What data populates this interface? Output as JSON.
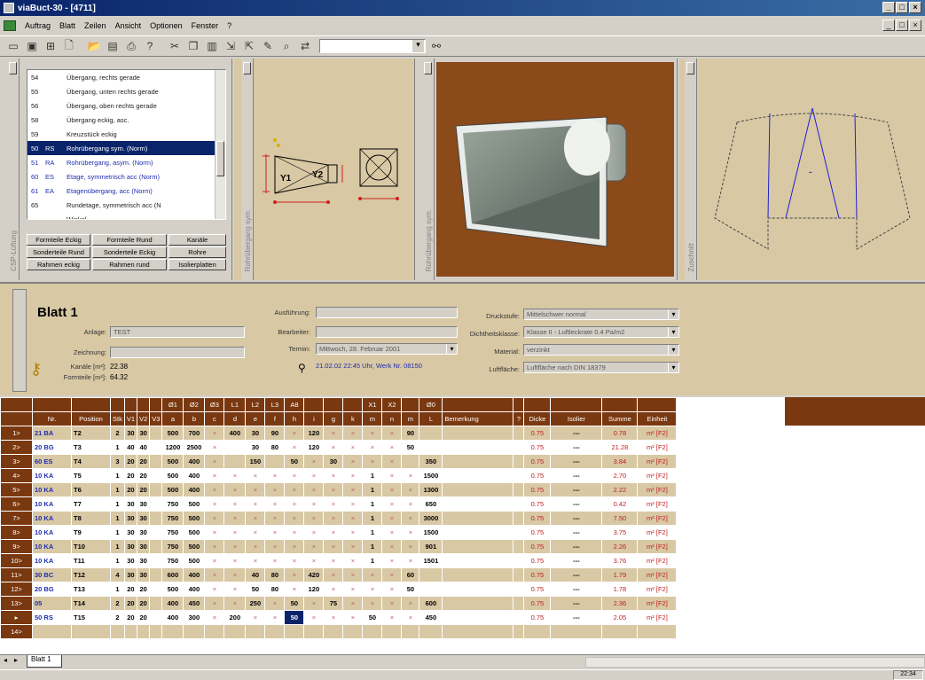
{
  "window": {
    "title": "viaBuct-30 - [4711]",
    "minimize": "_",
    "maximize": "□",
    "close": "×"
  },
  "menu": [
    "Auftrag",
    "Blatt",
    "Zeilen",
    "Ansicht",
    "Optionen",
    "Fenster",
    "?"
  ],
  "parts_list": {
    "rows": [
      {
        "n": "54",
        "code": "",
        "name": "Übergang, rechts gerade"
      },
      {
        "n": "55",
        "code": "",
        "name": "Übergang, unten rechts gerade"
      },
      {
        "n": "56",
        "code": "",
        "name": "Übergang, oben rechts gerade"
      },
      {
        "n": "58",
        "code": "",
        "name": "Übergang eckig, asc."
      },
      {
        "n": "59",
        "code": "",
        "name": "Kreuzstück eckig"
      },
      {
        "n": "50",
        "code": "RS",
        "name": "Rohrübergang sym. (Norm)",
        "selected": true
      },
      {
        "n": "51",
        "code": "RA",
        "name": "Rohrübergang, asym. (Norm)"
      },
      {
        "n": "60",
        "code": "ES",
        "name": "Etage, symmetrisch acc (Norm)"
      },
      {
        "n": "61",
        "code": "EA",
        "name": "Etagenübergang, acc (Norm)"
      },
      {
        "n": "65",
        "code": "",
        "name": "Rundetage, symmetrisch acc (N"
      },
      {
        "n": "",
        "code": "",
        "name": "Winkel"
      }
    ],
    "buttons": [
      [
        "Formteile Eckig",
        "Formteile Rund",
        "Kanäle"
      ],
      [
        "Sonderteile Rund",
        "Sonderteile Eckig",
        "Rohre"
      ],
      [
        "Rahmen eckig",
        "Rahmen rund",
        "Isolierplatten"
      ]
    ],
    "strip_label": "CSP-Lüftung"
  },
  "drawing": {
    "labels": [
      "Y1",
      "Y2"
    ],
    "strip_label": "Rohrübergang sym."
  },
  "view3d": {
    "strip_label": "Rohrübergang sym."
  },
  "unfold": {
    "strip_label": "Zuschnitt"
  },
  "sheet": {
    "title": "Blatt 1",
    "anlage_label": "Anlage:",
    "anlage_value": "TEST",
    "zeichnung_label": "Zeichnung:",
    "zeichnung_value": "",
    "kanaele_label": "Kanäle [m²]:",
    "kanaele_value": "22.38",
    "formteile_label": "Formteile [m²]:",
    "formteile_value": "64.32",
    "ausfuehrung_label": "Ausführung:",
    "ausfuehrung_value": "",
    "bearbeiter_label": "Bearbeiter:",
    "bearbeiter_value": "",
    "termin_label": "Termin:",
    "termin_value": "Mittwoch, 28. Februar 2001",
    "info_text": "21.02.02 22:45 Uhr, Werk Nr. 08150",
    "drucksfufe_label": "Druckstufe:",
    "drucksfufe_value": "Mittelschwer normal",
    "dichtheit_label": "Dichtheitsklasse:",
    "dichtheit_value": "Klasse II - Luftleckrate 0.4 Pa/m2",
    "material_label": "Material:",
    "material_value": "verzinkt",
    "luftflaeche_label": "Luftfläche:",
    "luftflaeche_value": "Luftfläche nach DIN 18379"
  },
  "grid": {
    "header1": [
      "",
      "",
      "",
      "",
      "",
      "",
      "",
      "Ø1",
      "Ø2",
      "Ø3",
      "L1",
      "L2",
      "L3",
      "A8",
      "",
      "",
      "",
      "X1",
      "X2",
      "",
      "Ø0",
      "",
      "",
      "",
      "",
      "",
      ""
    ],
    "header2": [
      "",
      "Nr.",
      "Position",
      "Stk",
      "V1",
      "V2",
      "V3",
      "a",
      "b",
      "c",
      "d",
      "e",
      "f",
      "h",
      "i",
      "g",
      "k",
      "m",
      "n",
      "m",
      "L",
      "Bemerkung",
      "?",
      "Dicke",
      "Isolier",
      "Summe",
      "Einheit"
    ],
    "rows": [
      {
        "rh": "1>",
        "nr": "21 BA",
        "pos": "T2",
        "stk": "2",
        "v1": "30",
        "v2": "30",
        "a": "500",
        "b": "700",
        "d": "400",
        "e": "30",
        "f": "90",
        "i": "120",
        "m": "90",
        "L": "",
        "dicke": "0.75",
        "iso": "---",
        "summe": "0.78",
        "einheit": "m² [F2]"
      },
      {
        "rh": "2>",
        "nr": "20 BG",
        "pos": "T3",
        "stk": "1",
        "v1": "40",
        "v2": "40",
        "a": "1200",
        "b": "2500",
        "d": "",
        "e": "30",
        "f": "80",
        "i": "120",
        "m": "50",
        "L": "",
        "dicke": "0.75",
        "iso": "---",
        "summe": "21.28",
        "einheit": "m² [F2]"
      },
      {
        "rh": "3>",
        "nr": "60 ES",
        "pos": "T4",
        "stk": "3",
        "v1": "20",
        "v2": "20",
        "a": "500",
        "b": "400",
        "d": "",
        "e": "150",
        "f": "",
        "h": "50",
        "g": "30",
        "m": "",
        "L": "350",
        "dicke": "0.75",
        "iso": "---",
        "summe": "3.84",
        "einheit": "m² [F2]"
      },
      {
        "rh": "4>",
        "nr": "10 KA",
        "pos": "T5",
        "stk": "1",
        "v1": "20",
        "v2": "20",
        "a": "500",
        "b": "400",
        "x1": "1",
        "L": "1500",
        "dicke": "0.75",
        "iso": "---",
        "summe": "2.70",
        "einheit": "m² [F2]"
      },
      {
        "rh": "5>",
        "nr": "10 KA",
        "pos": "T6",
        "stk": "1",
        "v1": "20",
        "v2": "20",
        "a": "500",
        "b": "400",
        "x1": "1",
        "L": "1300",
        "dicke": "0.75",
        "iso": "---",
        "summe": "2.22",
        "einheit": "m² [F2]"
      },
      {
        "rh": "6>",
        "nr": "10 KA",
        "pos": "T7",
        "stk": "1",
        "v1": "30",
        "v2": "30",
        "a": "750",
        "b": "500",
        "x1": "1",
        "L": "650",
        "dicke": "0.75",
        "iso": "---",
        "summe": "0.42",
        "einheit": "m² [F2]"
      },
      {
        "rh": "7>",
        "nr": "10 KA",
        "pos": "T8",
        "stk": "1",
        "v1": "30",
        "v2": "30",
        "a": "750",
        "b": "500",
        "x1": "1",
        "L": "3000",
        "dicke": "0.75",
        "iso": "---",
        "summe": "7.50",
        "einheit": "m² [F2]"
      },
      {
        "rh": "8>",
        "nr": "10 KA",
        "pos": "T9",
        "stk": "1",
        "v1": "30",
        "v2": "30",
        "a": "750",
        "b": "500",
        "x1": "1",
        "L": "1500",
        "dicke": "0.75",
        "iso": "---",
        "summe": "3.75",
        "einheit": "m² [F2]"
      },
      {
        "rh": "9>",
        "nr": "10 KA",
        "pos": "T10",
        "stk": "1",
        "v1": "30",
        "v2": "30",
        "a": "750",
        "b": "500",
        "x1": "1",
        "L": "901",
        "dicke": "0.75",
        "iso": "---",
        "summe": "2.26",
        "einheit": "m² [F2]"
      },
      {
        "rh": "10>",
        "nr": "10 KA",
        "pos": "T11",
        "stk": "1",
        "v1": "30",
        "v2": "30",
        "a": "750",
        "b": "500",
        "x1": "1",
        "L": "1501",
        "dicke": "0.75",
        "iso": "---",
        "summe": "3.76",
        "einheit": "m² [F2]"
      },
      {
        "rh": "11>",
        "nr": "30 BC",
        "pos": "T12",
        "stk": "4",
        "v1": "30",
        "v2": "30",
        "a": "600",
        "b": "400",
        "e": "40",
        "f": "80",
        "i": "420",
        "m": "60",
        "L": "",
        "dicke": "0.75",
        "iso": "---",
        "summe": "1.79",
        "einheit": "m² [F2]"
      },
      {
        "rh": "12>",
        "nr": "20 BG",
        "pos": "T13",
        "stk": "1",
        "v1": "20",
        "v2": "20",
        "a": "500",
        "b": "400",
        "e": "50",
        "f": "80",
        "i": "120",
        "m": "50",
        "L": "",
        "dicke": "0.75",
        "iso": "---",
        "summe": "1.78",
        "einheit": "m² [F2]"
      },
      {
        "rh": "13>",
        "nr": "05",
        "pos": "T14",
        "stk": "2",
        "v1": "20",
        "v2": "20",
        "a": "400",
        "b": "450",
        "e": "250",
        "h": "50",
        "g": "75",
        "L": "600",
        "dicke": "0.75",
        "iso": "---",
        "summe": "2.36",
        "einheit": "m² [F2]"
      },
      {
        "rh": "▸",
        "nr": "50 RS",
        "pos": "T15",
        "stk": "2",
        "v1": "20",
        "v2": "20",
        "a": "400",
        "b": "300",
        "d": "200",
        "h": "50",
        "x1": "50",
        "L": "450",
        "dicke": "0.75",
        "iso": "---",
        "summe": "2.05",
        "einheit": "m² [F2]",
        "hl": true
      },
      {
        "rh": "14>",
        "nr": "",
        "pos": "",
        "stk": "",
        "v1": "",
        "v2": "",
        "a": "",
        "b": "",
        "L": "",
        "dicke": "",
        "iso": "",
        "summe": "",
        "einheit": ""
      }
    ]
  },
  "sheet_tab": "Blatt 1",
  "clock": "22:34",
  "colors": {
    "header_brown": "#7a3810",
    "row_tan": "#d8c8a4",
    "selection_navy": "#0a246a",
    "position_blue": "#1e2db0"
  }
}
